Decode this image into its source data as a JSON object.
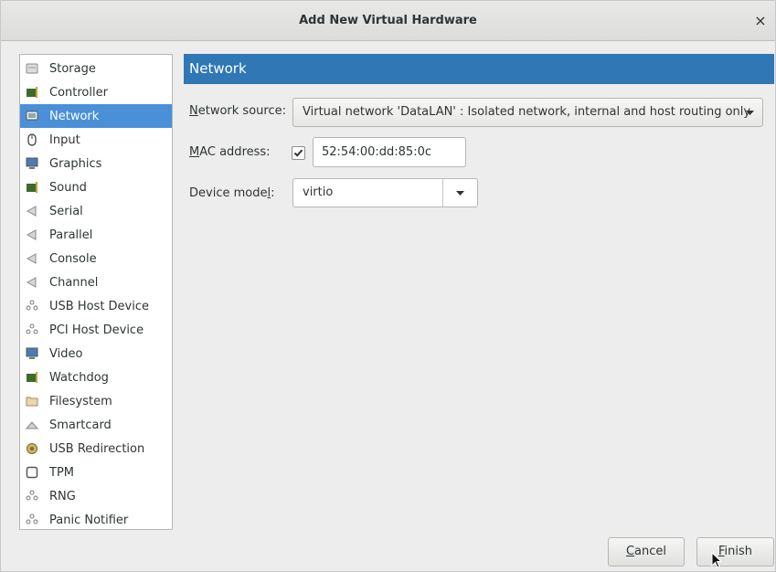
{
  "window": {
    "title": "Add New Virtual Hardware",
    "close_glyph": "×"
  },
  "hardware_list": {
    "selected_index": 2,
    "items": [
      {
        "label": "Storage",
        "icon": "storage-icon"
      },
      {
        "label": "Controller",
        "icon": "controller-icon"
      },
      {
        "label": "Network",
        "icon": "network-icon"
      },
      {
        "label": "Input",
        "icon": "mouse-icon"
      },
      {
        "label": "Graphics",
        "icon": "monitor-icon"
      },
      {
        "label": "Sound",
        "icon": "sound-card-icon"
      },
      {
        "label": "Serial",
        "icon": "serial-port-icon"
      },
      {
        "label": "Parallel",
        "icon": "parallel-port-icon"
      },
      {
        "label": "Console",
        "icon": "console-port-icon"
      },
      {
        "label": "Channel",
        "icon": "channel-port-icon"
      },
      {
        "label": "USB Host Device",
        "icon": "usb-host-icon"
      },
      {
        "label": "PCI Host Device",
        "icon": "pci-host-icon"
      },
      {
        "label": "Video",
        "icon": "video-icon"
      },
      {
        "label": "Watchdog",
        "icon": "watchdog-icon"
      },
      {
        "label": "Filesystem",
        "icon": "folder-icon"
      },
      {
        "label": "Smartcard",
        "icon": "smartcard-icon"
      },
      {
        "label": "USB Redirection",
        "icon": "usb-redirection-icon"
      },
      {
        "label": "TPM",
        "icon": "tpm-icon"
      },
      {
        "label": "RNG",
        "icon": "rng-icon"
      },
      {
        "label": "Panic Notifier",
        "icon": "panic-notifier-icon"
      }
    ]
  },
  "network_panel": {
    "header": "Network",
    "network_source_label": "Network source:",
    "network_source_value": "Virtual network 'DataLAN' : Isolated network, internal and host routing only",
    "mac_address_label": "MAC address:",
    "mac_enabled": true,
    "mac_address_value": "52:54:00:dd:85:0c",
    "device_model_label": "Device model:",
    "device_model_value": "virtio"
  },
  "buttons": {
    "cancel": "Cancel",
    "finish": "Finish"
  },
  "colors": {
    "selection": "#4a90d9",
    "header": "#2f77b5"
  }
}
